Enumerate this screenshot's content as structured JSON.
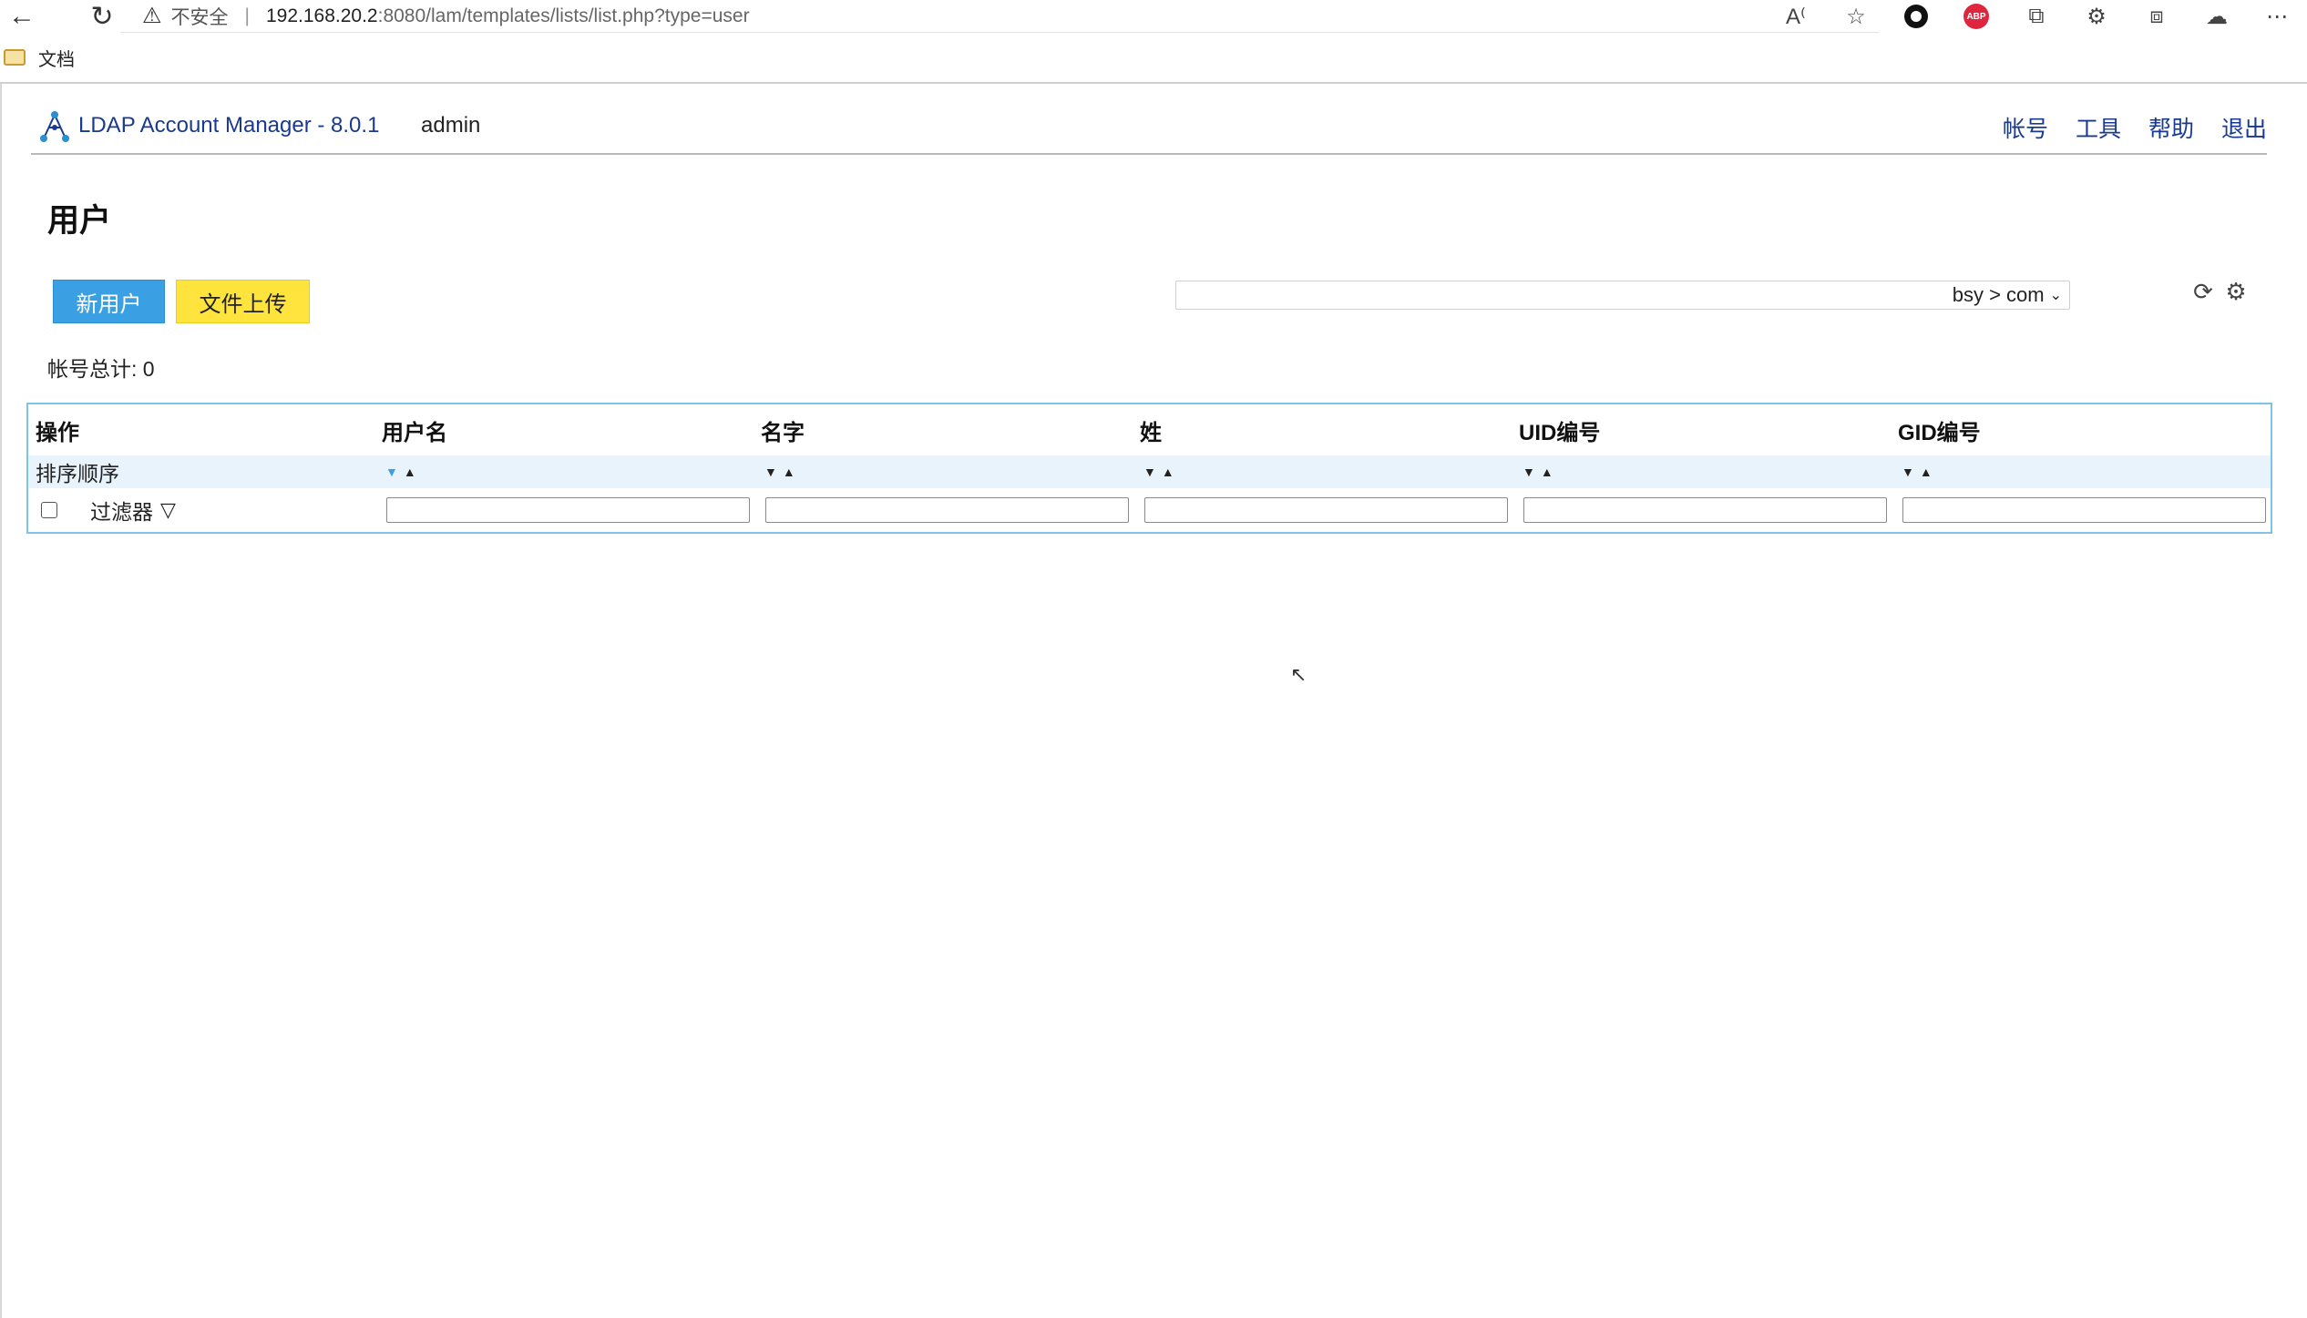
{
  "browser": {
    "insecure_label": "不安全",
    "url_host": "192.168.20.2",
    "url_path": ":8080/lam/templates/lists/list.php?type=user",
    "bookmark_folder": "文档"
  },
  "header": {
    "app_title": "LDAP Account Manager - 8.0.1",
    "user": "admin",
    "menu": [
      "帐号",
      "工具",
      "帮助",
      "退出"
    ]
  },
  "page": {
    "title": "用户",
    "new_button": "新用户",
    "upload_button": "文件上传",
    "suffix_value": "bsy > com",
    "account_count": "帐号总计: 0"
  },
  "table": {
    "columns": [
      "操作",
      "用户名",
      "名字",
      "姓",
      "UID编号",
      "GID编号"
    ],
    "sort_label": "排序顺序",
    "filter_label": "过滤器"
  },
  "colors": {
    "accent_blue": "#3aa0e3",
    "upload_yellow": "#ffe43d",
    "link_blue": "#1a3a8f",
    "table_border": "#7ec3e8"
  }
}
